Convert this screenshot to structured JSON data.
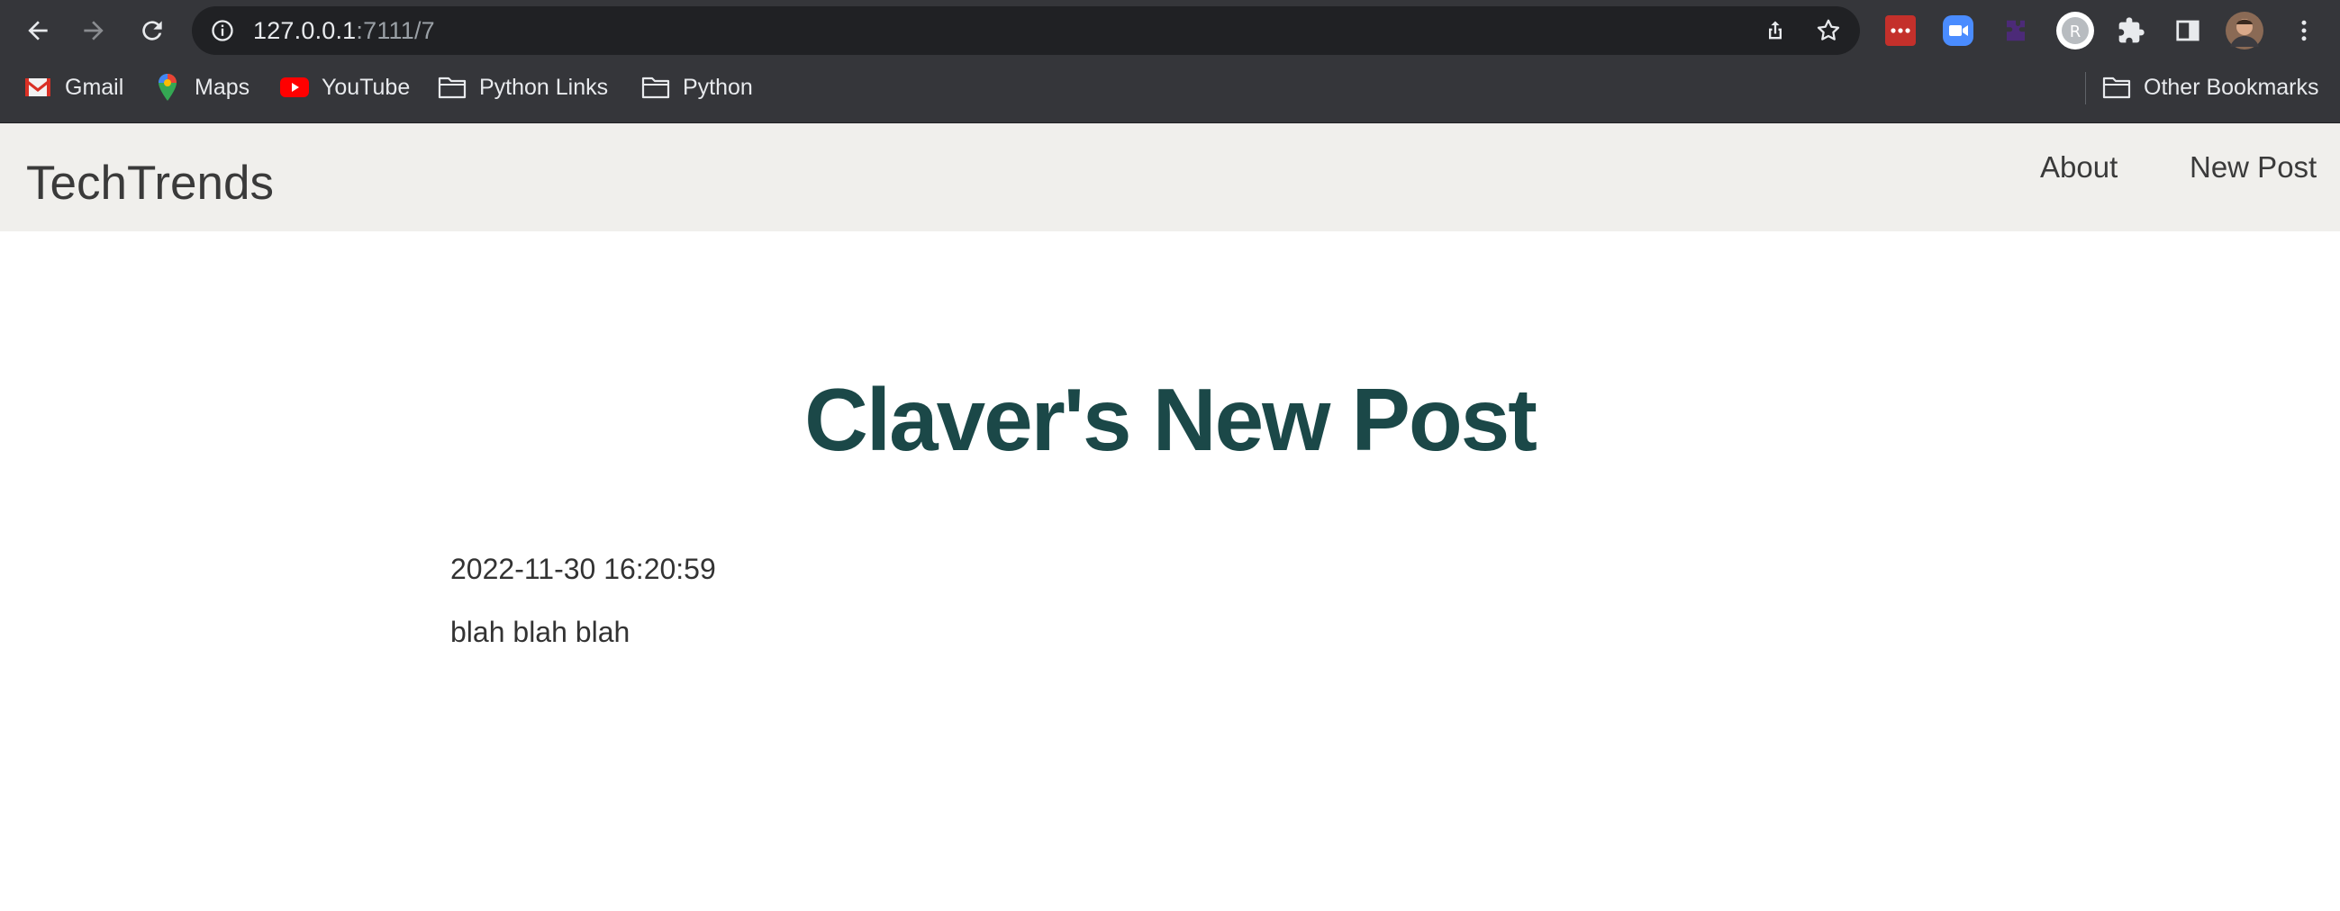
{
  "browser": {
    "url_host": "127.0.0.1",
    "url_path": ":7111/7",
    "bookmarks": [
      {
        "label": "Gmail",
        "icon": "gmail-icon"
      },
      {
        "label": "Maps",
        "icon": "maps-icon"
      },
      {
        "label": "YouTube",
        "icon": "youtube-icon"
      },
      {
        "label": "Python Links",
        "icon": "folder-icon"
      },
      {
        "label": "Python",
        "icon": "folder-icon"
      }
    ],
    "other_bookmarks": "Other Bookmarks",
    "extensions": [
      "lastpass-icon",
      "zoom-icon",
      "puzzle-purple-icon",
      "profile-ext-icon",
      "extensions-puzzle-icon",
      "side-panel-icon",
      "avatar",
      "menu-icon"
    ]
  },
  "site": {
    "brand": "TechTrends",
    "nav": {
      "about": "About",
      "new_post": "New Post"
    }
  },
  "post": {
    "title": "Claver's New Post",
    "date": "2022-11-30 16:20:59",
    "content": "blah blah blah"
  },
  "colors": {
    "chrome_bg": "#35363a",
    "omnibox_bg": "#202124",
    "navbar_bg": "#f0efec",
    "title_color": "#1b4848"
  }
}
